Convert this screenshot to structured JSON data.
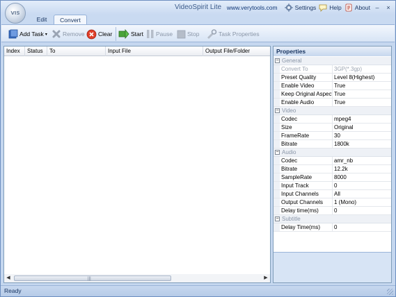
{
  "app": {
    "title": "VideoSpirit Lite",
    "orb_label": "VIS"
  },
  "titlebar": {
    "url": "www.verytools.com",
    "settings_label": "Settings",
    "help_label": "Help",
    "about_label": "About",
    "minimize": "–",
    "close": "×"
  },
  "tabs": [
    {
      "label": "Edit",
      "active": false
    },
    {
      "label": "Convert",
      "active": true
    }
  ],
  "toolbar": {
    "add_task": "Add Task",
    "remove": "Remove",
    "clear": "Clear",
    "start": "Start",
    "pause": "Pause",
    "stop": "Stop",
    "task_properties": "Task Properties"
  },
  "task_list": {
    "columns": [
      "Index",
      "Status",
      "To",
      "Input File",
      "Output File/Folder"
    ],
    "rows": []
  },
  "properties": {
    "title": "Properties",
    "groups": [
      {
        "name": "General",
        "items": [
          {
            "name": "Convert To",
            "value": "3GP(*.3gp)",
            "disabled": true
          },
          {
            "name": "Preset Quality",
            "value": "Level 8(Highest)"
          },
          {
            "name": "Enable Video",
            "value": "True"
          },
          {
            "name": "Keep Original Aspect",
            "value": "True"
          },
          {
            "name": "Enable Audio",
            "value": "True"
          }
        ]
      },
      {
        "name": "Video",
        "items": [
          {
            "name": "Codec",
            "value": "mpeg4"
          },
          {
            "name": "Size",
            "value": "Original"
          },
          {
            "name": "FrameRate",
            "value": "30"
          },
          {
            "name": "Bitrate",
            "value": "1800k"
          }
        ]
      },
      {
        "name": "Audio",
        "items": [
          {
            "name": "Codec",
            "value": "amr_nb"
          },
          {
            "name": "Bitrate",
            "value": "12.2k"
          },
          {
            "name": "SampleRate",
            "value": "8000"
          },
          {
            "name": "Input Track",
            "value": "0"
          },
          {
            "name": "Input Channels",
            "value": "All"
          },
          {
            "name": "Output Channels",
            "value": "1 (Mono)"
          },
          {
            "name": "Delay time(ms)",
            "value": "0"
          }
        ]
      },
      {
        "name": "Subtitle",
        "items": [
          {
            "name": "Delay Time(ms)",
            "value": "0"
          }
        ]
      }
    ]
  },
  "status": {
    "text": "Ready"
  },
  "colors": {
    "accent": "#15325f",
    "frame": "#c5d7ef",
    "disabled_text": "#8a96a8"
  }
}
